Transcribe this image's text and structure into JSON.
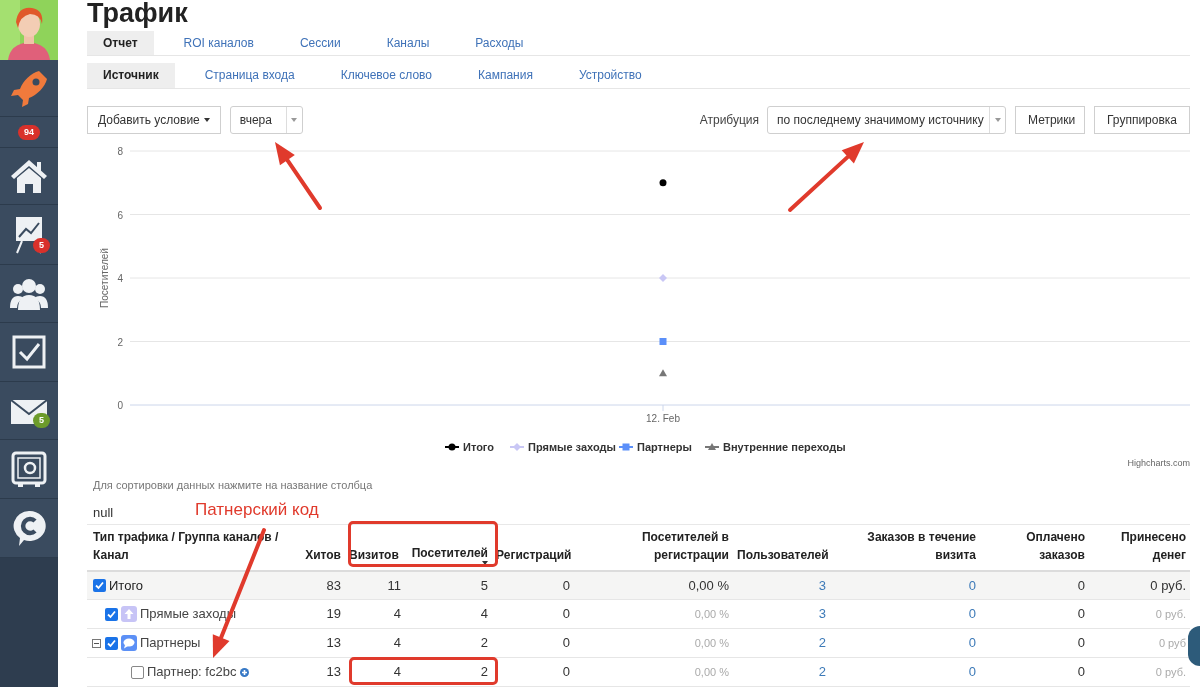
{
  "page_title": "Трафик",
  "sidebar": {
    "items": [
      {
        "kind": "rocket"
      },
      {
        "kind": "counter",
        "badge": "94",
        "color": "#d9312b"
      },
      {
        "kind": "home"
      },
      {
        "kind": "chart",
        "badge": "5",
        "color": "#d9312b"
      },
      {
        "kind": "people"
      },
      {
        "kind": "tasks"
      },
      {
        "kind": "mail",
        "badge": "5",
        "color": "#6c9b2b"
      },
      {
        "kind": "safe"
      },
      {
        "kind": "chat"
      }
    ]
  },
  "tabs": [
    {
      "label": "Отчет",
      "selected": true
    },
    {
      "label": "ROI каналов",
      "selected": false
    },
    {
      "label": "Сессии",
      "selected": false
    },
    {
      "label": "Каналы",
      "selected": false
    },
    {
      "label": "Расходы",
      "selected": false
    }
  ],
  "subtabs": [
    {
      "label": "Источник",
      "selected": true
    },
    {
      "label": "Страница входа",
      "selected": false
    },
    {
      "label": "Ключевое слово",
      "selected": false
    },
    {
      "label": "Кампания",
      "selected": false
    },
    {
      "label": "Устройство",
      "selected": false
    }
  ],
  "filters": {
    "add_condition": "Добавить условие",
    "period": "вчера",
    "attribution_label": "Атрибуция",
    "attribution": "по последнему значимому источнику",
    "buttons": [
      "Метрики",
      "Группировка"
    ]
  },
  "chart": {
    "chart_data": {
      "type": "scatter",
      "grid": true,
      "legend": "bottom",
      "ylabel": "Посетителей",
      "categories": [
        "12. Feb"
      ],
      "ylim": [
        0,
        8
      ],
      "yticks": [
        0,
        2,
        4,
        6,
        8
      ],
      "series": [
        {
          "name": "Итого",
          "color": "#000000",
          "values": [
            7
          ]
        },
        {
          "name": "Прямые заходы",
          "color": "#c9c7f5",
          "values": [
            4
          ]
        },
        {
          "name": "Партнеры",
          "color": "#5b8ff9",
          "values": [
            2
          ]
        },
        {
          "name": "Внутренние переходы",
          "color": "#777777",
          "values": [
            1
          ]
        }
      ]
    },
    "credit": "Highcharts.com"
  },
  "table": {
    "hint": "Для сортировки данных нажмите на название столбца",
    "caption": "null",
    "columns": [
      {
        "title": "Тип трафика / Группа каналов / Канал",
        "sorted": false
      },
      {
        "title": "Хитов",
        "sorted": false
      },
      {
        "title": "Визитов",
        "sorted": false
      },
      {
        "title": "Посетителей",
        "sorted": true
      },
      {
        "title": "Регистраций",
        "sorted": false
      },
      {
        "title": "Посетителей в регистрации",
        "sorted": false
      },
      {
        "title": "Пользователей",
        "sorted": false
      },
      {
        "title": "Заказов в течение визита",
        "sorted": false
      },
      {
        "title": "Оплачено заказов",
        "sorted": false
      },
      {
        "title": "Принесено денег",
        "sorted": false
      }
    ],
    "rows": [
      {
        "kind": "total",
        "checked": true,
        "cells": [
          "Итого",
          "83",
          "11",
          "5",
          "0",
          "0,00 %",
          "3",
          "0",
          "0",
          "0 руб."
        ],
        "children": [
          {
            "kind": "direct",
            "checked": true,
            "cells": [
              "Прямые заходы",
              "19",
              "4",
              "4",
              "0",
              "0,00 %",
              "3",
              "0",
              "0",
              "0 руб."
            ]
          },
          {
            "kind": "partners",
            "checked": true,
            "expanded": true,
            "cells": [
              "Партнеры",
              "13",
              "4",
              "2",
              "0",
              "0,00 %",
              "2",
              "0",
              "0",
              "0 руб"
            ],
            "children": [
              {
                "kind": "partner",
                "checked": false,
                "cells": [
                  "Партнер: fc2bc",
                  "13",
                  "4",
                  "2",
                  "0",
                  "0,00 %",
                  "2",
                  "0",
                  "0",
                  "0 руб."
                ]
              }
            ]
          }
        ]
      }
    ]
  },
  "annotation": {
    "label": "Патнерский код"
  }
}
